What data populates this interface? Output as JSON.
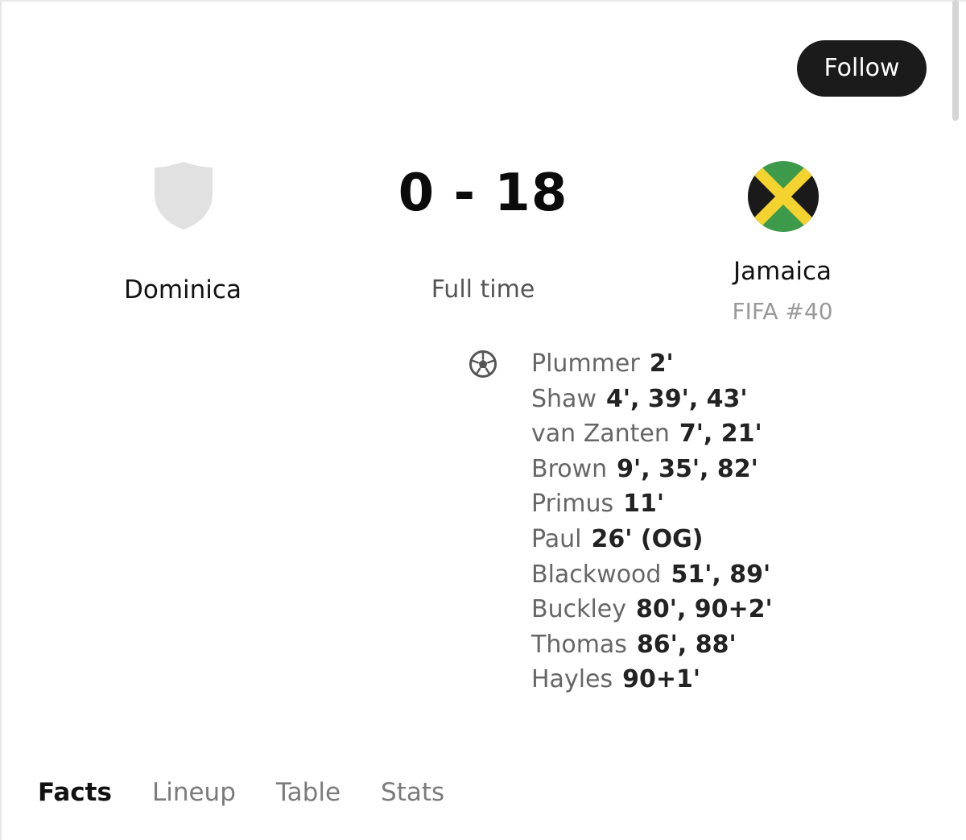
{
  "header": {
    "follow_label": "Follow"
  },
  "match": {
    "score": "0 - 18",
    "status": "Full time",
    "home": {
      "name": "Dominica",
      "crest_icon": "shield-placeholder-icon",
      "crest_color": "#e1e1e1"
    },
    "away": {
      "name": "Jamaica",
      "rank": "FIFA #40",
      "crest_icon": "jamaica-flag-icon",
      "flag_colors": {
        "green": "#3d9a4b",
        "gold": "#f4d330",
        "black": "#1a1a1a"
      }
    }
  },
  "goals": {
    "icon": "soccer-ball-icon",
    "scorers": [
      {
        "name": "Plummer",
        "minutes": "2'"
      },
      {
        "name": "Shaw",
        "minutes": "4', 39', 43'"
      },
      {
        "name": "van Zanten",
        "minutes": "7', 21'"
      },
      {
        "name": "Brown",
        "minutes": "9', 35', 82'"
      },
      {
        "name": "Primus",
        "minutes": "11'"
      },
      {
        "name": "Paul",
        "minutes": "26' (OG)"
      },
      {
        "name": "Blackwood",
        "minutes": "51', 89'"
      },
      {
        "name": "Buckley",
        "minutes": "80', 90+2'"
      },
      {
        "name": "Thomas",
        "minutes": "86', 88'"
      },
      {
        "name": "Hayles",
        "minutes": "90+1'"
      }
    ]
  },
  "tabs": [
    {
      "label": "Facts",
      "active": true
    },
    {
      "label": "Lineup",
      "active": false
    },
    {
      "label": "Table",
      "active": false
    },
    {
      "label": "Stats",
      "active": false
    }
  ],
  "colors": {
    "follow_bg": "#1b1b1b",
    "muted_text": "#9a9a9a"
  }
}
